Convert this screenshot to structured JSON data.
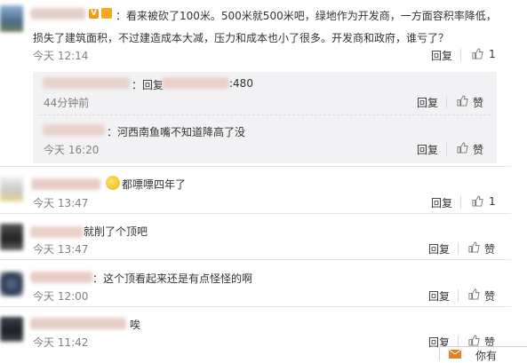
{
  "comments": [
    {
      "line1": "：看来被砍了100米。500米就500米吧，绿地作为开发商，一方面容积率降低，",
      "line2": "损失了建筑面积，不过建造成本大减，压力和成本也小了很多。开发商和政府，谁亏了？",
      "time": "今天 12:14",
      "reply_label": "回复",
      "like_count": "1",
      "badge": "V"
    },
    {
      "time": "今天 13:47",
      "reply_label": "回复",
      "like_count": "1",
      "text": "都嘌嘌四年了"
    },
    {
      "text": "就削了个顶吧",
      "time": "今天 13:47",
      "reply_label": "回复",
      "like_label": "赞"
    },
    {
      "text": "：这个顶看起来还是有点怪怪的啊",
      "time": "今天 12:00",
      "reply_label": "回复",
      "like_label": "赞"
    },
    {
      "text": "唉",
      "time": "今天 11:42",
      "reply_label": "回复",
      "like_label": "赞"
    }
  ],
  "replies": [
    {
      "prefix": "：回复",
      "suffix": ":480",
      "time": "44分钟前",
      "reply_label": "回复",
      "like_label": "赞"
    },
    {
      "text": "：河西南鱼嘴不知道降高了没",
      "time": "今天 16:20",
      "reply_label": "回复",
      "like_label": "赞"
    }
  ],
  "popup_text": "你有"
}
